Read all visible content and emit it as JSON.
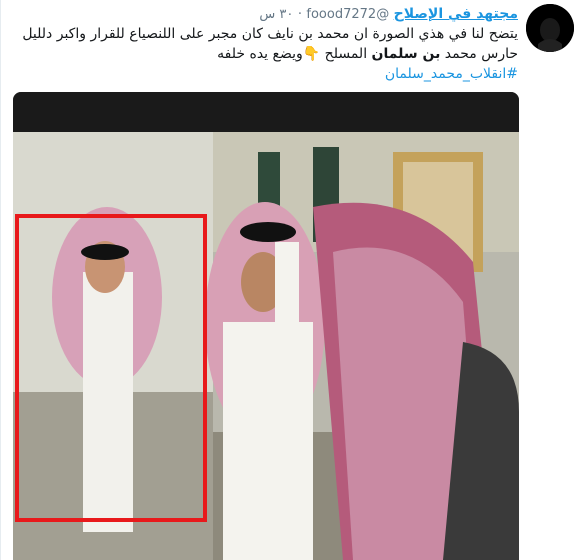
{
  "tweet": {
    "display_name": "مجتهد في الإصلاح",
    "handle": "@foood7272",
    "separator": "·",
    "time": "٣٠ س",
    "hashtag": "#انقلاب_محمد_سلمان",
    "line1": "يتضح لنا في هذي الصورة ان محمد بن نايف كان مجبر على اللنصياع للقرار واكبر دلليل",
    "line2_a": "حارس محمد ",
    "line2_bold": "بن سلمان",
    "line2_b": " المسلح ",
    "emoji": "👇",
    "line2_c": "ويضع يده خلفه"
  },
  "media": {
    "type": "photo",
    "highlight_color": "#e8191b"
  }
}
